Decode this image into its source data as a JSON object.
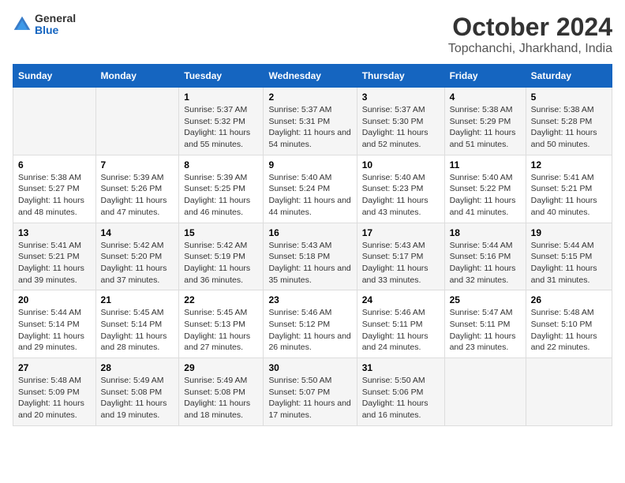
{
  "logo": {
    "general": "General",
    "blue": "Blue"
  },
  "title": "October 2024",
  "subtitle": "Topchanchi, Jharkhand, India",
  "days": [
    "Sunday",
    "Monday",
    "Tuesday",
    "Wednesday",
    "Thursday",
    "Friday",
    "Saturday"
  ],
  "weeks": [
    [
      {
        "day": "",
        "sunrise": "",
        "sunset": "",
        "daylight": ""
      },
      {
        "day": "",
        "sunrise": "",
        "sunset": "",
        "daylight": ""
      },
      {
        "day": "1",
        "sunrise": "Sunrise: 5:37 AM",
        "sunset": "Sunset: 5:32 PM",
        "daylight": "Daylight: 11 hours and 55 minutes."
      },
      {
        "day": "2",
        "sunrise": "Sunrise: 5:37 AM",
        "sunset": "Sunset: 5:31 PM",
        "daylight": "Daylight: 11 hours and 54 minutes."
      },
      {
        "day": "3",
        "sunrise": "Sunrise: 5:37 AM",
        "sunset": "Sunset: 5:30 PM",
        "daylight": "Daylight: 11 hours and 52 minutes."
      },
      {
        "day": "4",
        "sunrise": "Sunrise: 5:38 AM",
        "sunset": "Sunset: 5:29 PM",
        "daylight": "Daylight: 11 hours and 51 minutes."
      },
      {
        "day": "5",
        "sunrise": "Sunrise: 5:38 AM",
        "sunset": "Sunset: 5:28 PM",
        "daylight": "Daylight: 11 hours and 50 minutes."
      }
    ],
    [
      {
        "day": "6",
        "sunrise": "Sunrise: 5:38 AM",
        "sunset": "Sunset: 5:27 PM",
        "daylight": "Daylight: 11 hours and 48 minutes."
      },
      {
        "day": "7",
        "sunrise": "Sunrise: 5:39 AM",
        "sunset": "Sunset: 5:26 PM",
        "daylight": "Daylight: 11 hours and 47 minutes."
      },
      {
        "day": "8",
        "sunrise": "Sunrise: 5:39 AM",
        "sunset": "Sunset: 5:25 PM",
        "daylight": "Daylight: 11 hours and 46 minutes."
      },
      {
        "day": "9",
        "sunrise": "Sunrise: 5:40 AM",
        "sunset": "Sunset: 5:24 PM",
        "daylight": "Daylight: 11 hours and 44 minutes."
      },
      {
        "day": "10",
        "sunrise": "Sunrise: 5:40 AM",
        "sunset": "Sunset: 5:23 PM",
        "daylight": "Daylight: 11 hours and 43 minutes."
      },
      {
        "day": "11",
        "sunrise": "Sunrise: 5:40 AM",
        "sunset": "Sunset: 5:22 PM",
        "daylight": "Daylight: 11 hours and 41 minutes."
      },
      {
        "day": "12",
        "sunrise": "Sunrise: 5:41 AM",
        "sunset": "Sunset: 5:21 PM",
        "daylight": "Daylight: 11 hours and 40 minutes."
      }
    ],
    [
      {
        "day": "13",
        "sunrise": "Sunrise: 5:41 AM",
        "sunset": "Sunset: 5:21 PM",
        "daylight": "Daylight: 11 hours and 39 minutes."
      },
      {
        "day": "14",
        "sunrise": "Sunrise: 5:42 AM",
        "sunset": "Sunset: 5:20 PM",
        "daylight": "Daylight: 11 hours and 37 minutes."
      },
      {
        "day": "15",
        "sunrise": "Sunrise: 5:42 AM",
        "sunset": "Sunset: 5:19 PM",
        "daylight": "Daylight: 11 hours and 36 minutes."
      },
      {
        "day": "16",
        "sunrise": "Sunrise: 5:43 AM",
        "sunset": "Sunset: 5:18 PM",
        "daylight": "Daylight: 11 hours and 35 minutes."
      },
      {
        "day": "17",
        "sunrise": "Sunrise: 5:43 AM",
        "sunset": "Sunset: 5:17 PM",
        "daylight": "Daylight: 11 hours and 33 minutes."
      },
      {
        "day": "18",
        "sunrise": "Sunrise: 5:44 AM",
        "sunset": "Sunset: 5:16 PM",
        "daylight": "Daylight: 11 hours and 32 minutes."
      },
      {
        "day": "19",
        "sunrise": "Sunrise: 5:44 AM",
        "sunset": "Sunset: 5:15 PM",
        "daylight": "Daylight: 11 hours and 31 minutes."
      }
    ],
    [
      {
        "day": "20",
        "sunrise": "Sunrise: 5:44 AM",
        "sunset": "Sunset: 5:14 PM",
        "daylight": "Daylight: 11 hours and 29 minutes."
      },
      {
        "day": "21",
        "sunrise": "Sunrise: 5:45 AM",
        "sunset": "Sunset: 5:14 PM",
        "daylight": "Daylight: 11 hours and 28 minutes."
      },
      {
        "day": "22",
        "sunrise": "Sunrise: 5:45 AM",
        "sunset": "Sunset: 5:13 PM",
        "daylight": "Daylight: 11 hours and 27 minutes."
      },
      {
        "day": "23",
        "sunrise": "Sunrise: 5:46 AM",
        "sunset": "Sunset: 5:12 PM",
        "daylight": "Daylight: 11 hours and 26 minutes."
      },
      {
        "day": "24",
        "sunrise": "Sunrise: 5:46 AM",
        "sunset": "Sunset: 5:11 PM",
        "daylight": "Daylight: 11 hours and 24 minutes."
      },
      {
        "day": "25",
        "sunrise": "Sunrise: 5:47 AM",
        "sunset": "Sunset: 5:11 PM",
        "daylight": "Daylight: 11 hours and 23 minutes."
      },
      {
        "day": "26",
        "sunrise": "Sunrise: 5:48 AM",
        "sunset": "Sunset: 5:10 PM",
        "daylight": "Daylight: 11 hours and 22 minutes."
      }
    ],
    [
      {
        "day": "27",
        "sunrise": "Sunrise: 5:48 AM",
        "sunset": "Sunset: 5:09 PM",
        "daylight": "Daylight: 11 hours and 20 minutes."
      },
      {
        "day": "28",
        "sunrise": "Sunrise: 5:49 AM",
        "sunset": "Sunset: 5:08 PM",
        "daylight": "Daylight: 11 hours and 19 minutes."
      },
      {
        "day": "29",
        "sunrise": "Sunrise: 5:49 AM",
        "sunset": "Sunset: 5:08 PM",
        "daylight": "Daylight: 11 hours and 18 minutes."
      },
      {
        "day": "30",
        "sunrise": "Sunrise: 5:50 AM",
        "sunset": "Sunset: 5:07 PM",
        "daylight": "Daylight: 11 hours and 17 minutes."
      },
      {
        "day": "31",
        "sunrise": "Sunrise: 5:50 AM",
        "sunset": "Sunset: 5:06 PM",
        "daylight": "Daylight: 11 hours and 16 minutes."
      },
      {
        "day": "",
        "sunrise": "",
        "sunset": "",
        "daylight": ""
      },
      {
        "day": "",
        "sunrise": "",
        "sunset": "",
        "daylight": ""
      }
    ]
  ]
}
